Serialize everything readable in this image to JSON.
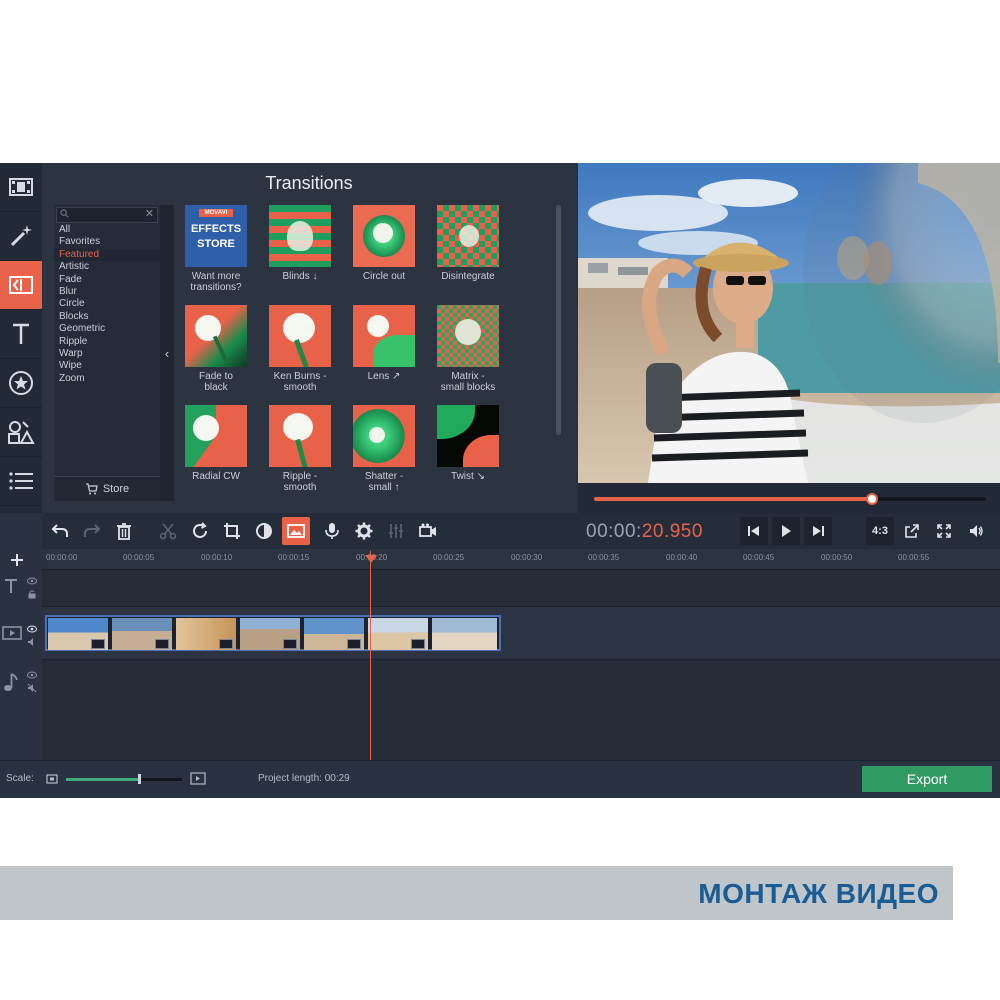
{
  "panel": {
    "title": "Transitions",
    "categories": [
      "All",
      "Favorites",
      "Featured",
      "Artistic",
      "Fade",
      "Blur",
      "Circle",
      "Blocks",
      "Geometric",
      "Ripple",
      "Warp",
      "Wipe",
      "Zoom"
    ],
    "selected_category": "Featured",
    "store_label": "Store",
    "promo_line1": "MOVAVI",
    "promo_line2": "EFFECTS",
    "promo_line3": "STORE",
    "tiles": [
      "Want more\ntransitions?",
      "Blinds ↓",
      "Circle out",
      "Disintegrate",
      "Fade to\nblack",
      "Ken Burns -\nsmooth",
      "Lens ↗",
      "Matrix -\nsmall blocks",
      "Radial CW",
      "Ripple -\nsmooth",
      "Shatter -\nsmall ↑",
      "Twist ↘"
    ]
  },
  "player": {
    "timecode_main": "00:00:",
    "timecode_accent": "20.950",
    "aspect": "4:3",
    "progress": 0.71
  },
  "timeline": {
    "ticks": [
      "00:00:00",
      "00:00:05",
      "00:00:10",
      "00:00:15",
      "00:00:20",
      "00:00:25",
      "00:00:30",
      "00:00:35",
      "00:00:40",
      "00:00:45",
      "00:00:50",
      "00:00:55"
    ]
  },
  "status": {
    "scale_label": "Scale:",
    "scale_value": 0.62,
    "project_length": "Project length:  00:29",
    "export_label": "Export"
  },
  "banner": {
    "text": "МОНТАЖ ВИДЕО"
  },
  "colors": {
    "accent": "#e8624a",
    "export": "#2f9a61",
    "banner_text": "#1a5d96"
  }
}
